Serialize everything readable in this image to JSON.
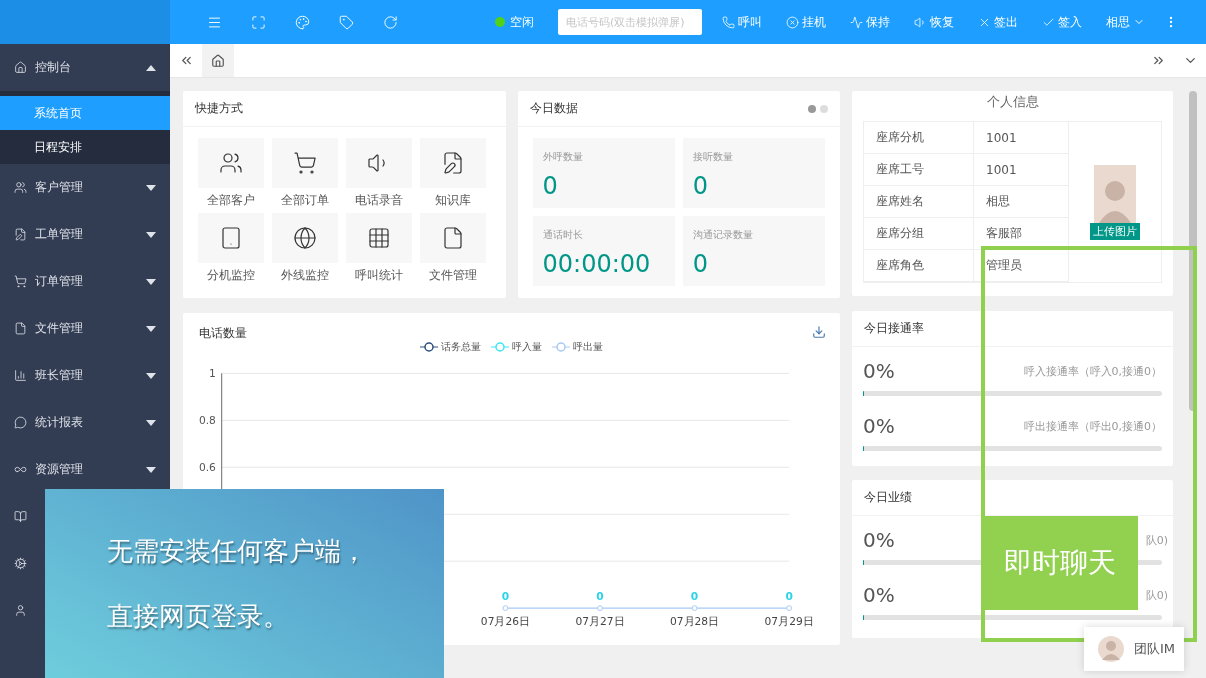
{
  "topbar": {
    "tools": [
      {
        "kind": "menu"
      },
      {
        "kind": "fullscreen"
      },
      {
        "kind": "palette"
      },
      {
        "kind": "tag"
      },
      {
        "kind": "refresh"
      }
    ],
    "status": {
      "label": "空闲",
      "color": "#52d11a"
    },
    "phone_field": {
      "placeholder": "电话号码(双击模拟弹屏)"
    },
    "actions": [
      {
        "label": "呼叫",
        "kind": "call"
      },
      {
        "label": "挂机",
        "kind": "hangup"
      },
      {
        "label": "保持",
        "kind": "hold"
      },
      {
        "label": "恢复",
        "kind": "resume"
      },
      {
        "label": "签出",
        "kind": "signout"
      },
      {
        "label": "签入",
        "kind": "signin"
      }
    ],
    "user": "相思"
  },
  "sidebar": {
    "items": [
      {
        "label": "控制台",
        "kind": "home",
        "expanded": true,
        "children": [
          {
            "label": "系统首页",
            "selected": true
          },
          {
            "label": "日程安排",
            "selected": false
          }
        ]
      },
      {
        "label": "客户管理",
        "kind": "users",
        "expanded": false
      },
      {
        "label": "工单管理",
        "kind": "ticket",
        "expanded": false
      },
      {
        "label": "订单管理",
        "kind": "cart",
        "expanded": false
      },
      {
        "label": "文件管理",
        "kind": "file",
        "expanded": false
      },
      {
        "label": "班长管理",
        "kind": "chart",
        "expanded": false
      },
      {
        "label": "统计报表",
        "kind": "chat",
        "expanded": false
      },
      {
        "label": "资源管理",
        "kind": "link",
        "expanded": false
      },
      {
        "kind": "book"
      },
      {
        "kind": "gear"
      },
      {
        "kind": "user"
      }
    ]
  },
  "shortcuts": {
    "title": "快捷方式",
    "items": [
      {
        "label": "全部客户",
        "kind": "users"
      },
      {
        "label": "全部订单",
        "kind": "cart"
      },
      {
        "label": "电话录音",
        "kind": "speaker"
      },
      {
        "label": "知识库",
        "kind": "doc"
      },
      {
        "label": "分机监控",
        "kind": "tablet"
      },
      {
        "label": "外线监控",
        "kind": "globe"
      },
      {
        "label": "呼叫统计",
        "kind": "grid"
      },
      {
        "label": "文件管理",
        "kind": "file"
      }
    ]
  },
  "today": {
    "title": "今日数据",
    "pager": [
      {
        "selected": true
      },
      {
        "selected": false
      }
    ],
    "stats": [
      {
        "label": "外呼数量",
        "value": "0"
      },
      {
        "label": "接听数量",
        "value": "0"
      },
      {
        "label": "通话时长",
        "value": "00:00:00"
      },
      {
        "label": "沟通记录数量",
        "value": "0"
      }
    ]
  },
  "call_chart": {
    "title": "电话数量",
    "chart_data": {
      "type": "line",
      "categories": [
        null,
        null,
        null,
        "07月26日",
        "07月27日",
        "07月28日",
        "07月29日"
      ],
      "series": [
        {
          "name": "话务总量",
          "color": "#2f4f7f",
          "marker": "circle",
          "values": [
            null,
            null,
            null,
            null,
            null,
            null,
            null
          ]
        },
        {
          "name": "呼入量",
          "color": "#3ee6f0",
          "marker": "circle",
          "values": [
            null,
            null,
            null,
            null,
            null,
            null,
            null
          ]
        },
        {
          "name": "呼出量",
          "color": "#a8c8f5",
          "marker": "circle",
          "values": [
            null,
            null,
            null,
            0,
            0,
            0,
            0
          ],
          "value_labels": [
            null,
            null,
            null,
            "0",
            "0",
            "0",
            "0"
          ]
        }
      ],
      "ylim": [
        0,
        1
      ],
      "yticks": [
        0.6,
        0.8,
        1
      ],
      "grid": true
    }
  },
  "profile": {
    "title": "个人信息",
    "rows": [
      {
        "label": "座席分机",
        "value": "1001"
      },
      {
        "label": "座席工号",
        "value": "1001"
      },
      {
        "label": "座席姓名",
        "value": "相思"
      },
      {
        "label": "座席分组",
        "value": "客服部"
      },
      {
        "label": "座席角色",
        "value": "管理员"
      }
    ],
    "upload_button": "上传图片"
  },
  "connect_rate": {
    "title": "今日接通率",
    "rows": [
      {
        "value": "0%",
        "label": "呼入接通率（呼入0,接通0）",
        "level": 0
      },
      {
        "value": "0%",
        "label": "呼出接通率（呼出0,接通0）",
        "level": 0
      }
    ]
  },
  "performance": {
    "title": "今日业绩",
    "rows": [
      {
        "value": "0%",
        "label": "队0)",
        "level": 0
      },
      {
        "value": "0%",
        "label": "队0)",
        "level": 0
      }
    ]
  },
  "promo": {
    "lines": [
      "无需安装任何客户端，",
      "直接网页登录。"
    ]
  },
  "callout": {
    "label": "即时聊天"
  },
  "im_widget": {
    "label": "团队IM"
  }
}
